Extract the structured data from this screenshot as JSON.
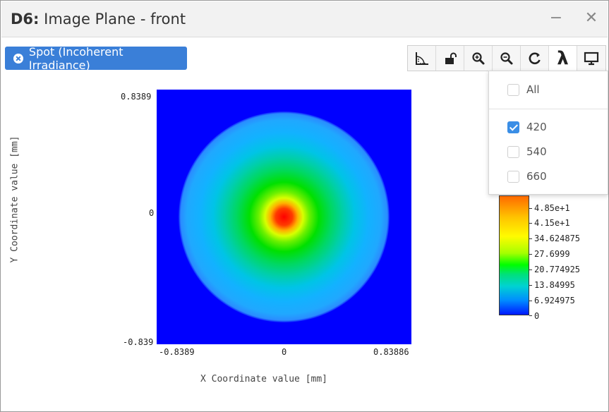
{
  "window": {
    "title_prefix": "D6:",
    "title_rest": " Image Plane - front",
    "minimize_glyph": "−",
    "close_glyph": "✕"
  },
  "spot_button": {
    "label": "Spot (Incoherent Irradiance)",
    "icon": "close-circle-icon",
    "color": "#3a7fd8"
  },
  "toolbar": {
    "buttons": [
      {
        "icon": "ruler-angle-icon"
      },
      {
        "icon": "unlock-icon"
      },
      {
        "icon": "zoom-in-icon"
      },
      {
        "icon": "zoom-out-icon"
      },
      {
        "icon": "refresh-icon"
      },
      {
        "icon": "lambda-icon",
        "glyph": "λ",
        "active": true
      },
      {
        "icon": "monitor-icon"
      }
    ]
  },
  "wavelength_menu": {
    "all_label": "All",
    "items": [
      {
        "label": "420",
        "checked": true
      },
      {
        "label": "540",
        "checked": false
      },
      {
        "label": "660",
        "checked": false
      }
    ]
  },
  "plot": {
    "ylabel": "Y Coordinate value [mm]",
    "xlabel": "X Coordinate value [mm]",
    "y_ticks": [
      "0.8389",
      "0",
      "-0.839"
    ],
    "x_ticks": [
      "-0.8389",
      "0",
      "0.83886"
    ],
    "colorbar_labels": [
      "4.85e+1",
      "4.15e+1",
      "34.624875",
      "27.6999",
      "20.774925",
      "13.84995",
      "6.924975",
      "0"
    ]
  }
}
